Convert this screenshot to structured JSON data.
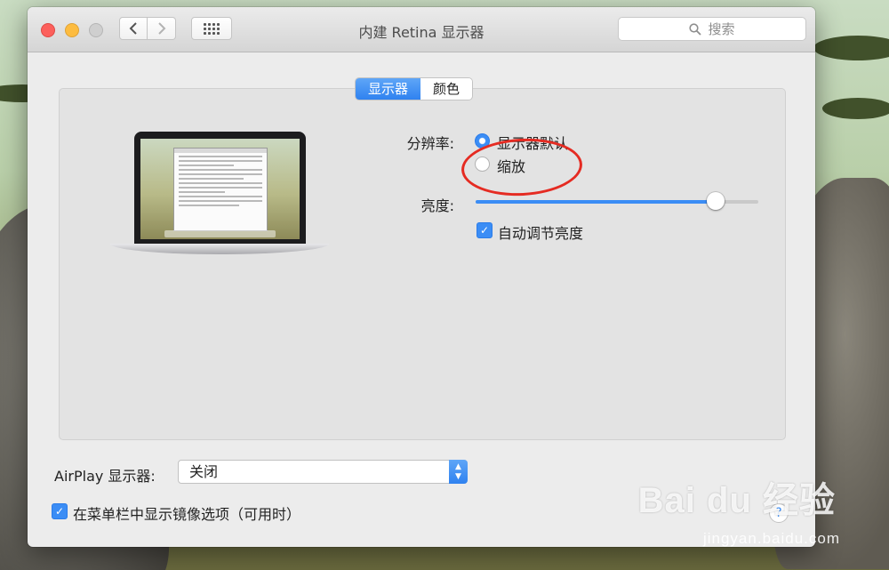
{
  "window": {
    "title": "内建 Retina 显示器",
    "search_placeholder": "搜索"
  },
  "toolbar": {
    "back_icon": "chevron-left-icon",
    "forward_icon": "chevron-right-icon",
    "grid_icon": "grid-icon"
  },
  "tabs": [
    {
      "label": "显示器",
      "active": true
    },
    {
      "label": "颜色",
      "active": false
    }
  ],
  "resolution": {
    "label": "分辨率:",
    "options": [
      {
        "label": "显示器默认",
        "selected": true
      },
      {
        "label": "缩放",
        "selected": false
      }
    ]
  },
  "brightness": {
    "label": "亮度:",
    "value": 0.85,
    "auto_label": "自动调节亮度",
    "auto_checked": true
  },
  "airplay": {
    "label": "AirPlay 显示器:",
    "value": "关闭"
  },
  "mirror_option": {
    "label": "在菜单栏中显示镜像选项（可用时）",
    "checked": true
  },
  "help_label": "?",
  "watermark": {
    "logo_text": "Bai du 经验",
    "url": "jingyan.baidu.com"
  },
  "colors": {
    "accent": "#3b8df5",
    "annotation": "#e52b22"
  }
}
